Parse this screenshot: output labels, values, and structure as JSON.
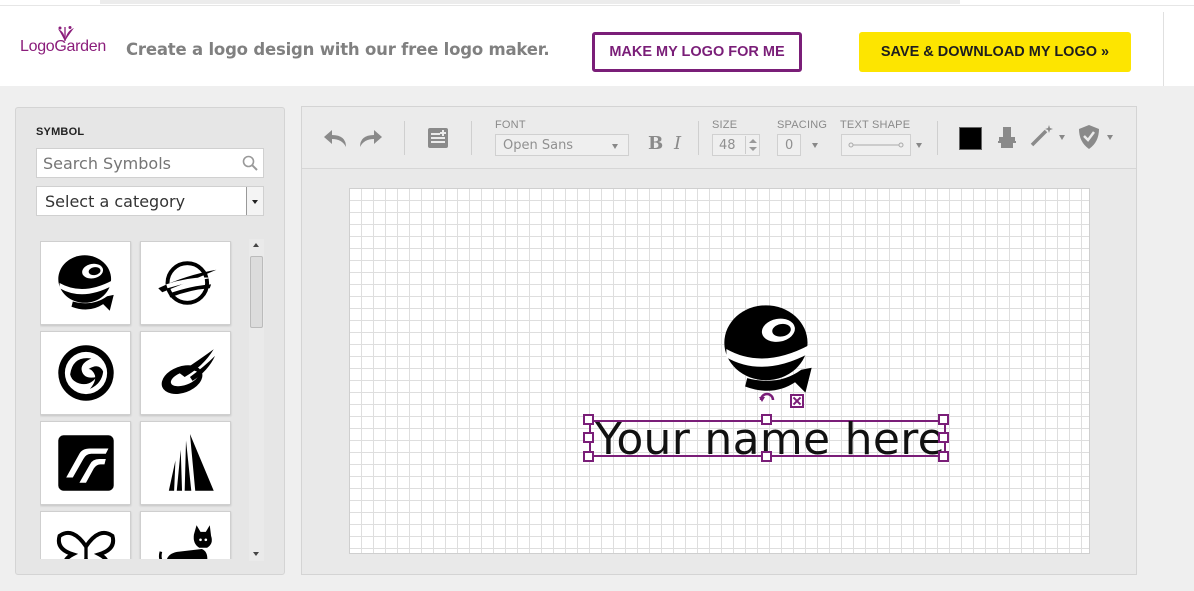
{
  "brand": {
    "name": "LogoGarden",
    "logo_colors": "#8b1d7b"
  },
  "header": {
    "tagline": "Create a logo design with our free logo maker.",
    "make_button": "MAKE MY LOGO FOR ME",
    "save_button": "SAVE & DOWNLOAD MY LOGO »"
  },
  "symbols": {
    "title": "SYMBOL",
    "search_placeholder": "Search Symbols",
    "category_value": "Select a category",
    "thumbnails": [
      "globe-arrow-symbol",
      "swoosh-globe-symbol",
      "circle-swirl-symbol",
      "orbit-swoosh-symbol",
      "square-stripes-symbol",
      "triangle-stripes-symbol",
      "butterfly-symbol",
      "cat-symbol"
    ]
  },
  "toolbar": {
    "font_label": "FONT",
    "font_value": "Open Sans",
    "bold_label": "B",
    "italic_label": "I",
    "size_label": "SIZE",
    "size_value": "48",
    "spacing_label": "SPACING",
    "spacing_value": "0",
    "text_shape_label": "TEXT SHAPE",
    "text_color": "#000000"
  },
  "canvas": {
    "text": "Your name here",
    "selection_color": "#7a1e78"
  },
  "colors": {
    "accent": "#7a1e78",
    "save_button_bg": "#fde500"
  }
}
